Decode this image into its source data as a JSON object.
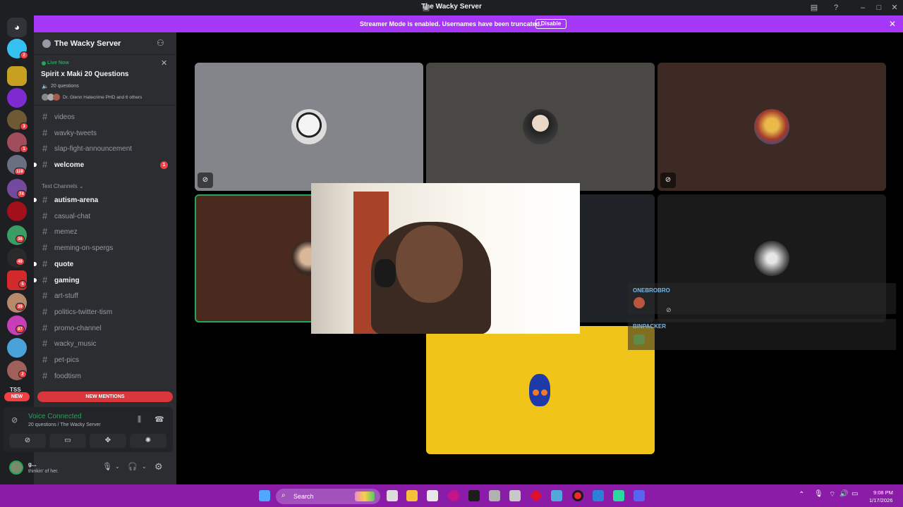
{
  "window": {
    "title": "The Wacky Server"
  },
  "banner": {
    "message": "Streamer Mode is enabled. Usernames have been truncated.",
    "disable_label": "Disable"
  },
  "server_list": {
    "badges": [
      "2",
      "3",
      "1",
      "119",
      "74",
      "36",
      "40",
      "5",
      "39",
      "87",
      "2"
    ],
    "new_label": "NEW",
    "tss_label": "TSS"
  },
  "sidebar": {
    "server_name": "The Wacky Server",
    "live": {
      "status": "Live Now",
      "title": "Spirit x Maki 20 Questions",
      "channel": "20 questions",
      "participants": "Dr. Glenn Hatecrime PHD and 6 others"
    },
    "channels_top": [
      {
        "name": "videos",
        "bold": false
      },
      {
        "name": "wavky-tweets",
        "bold": false
      },
      {
        "name": "slap-fight-announcement",
        "bold": false
      },
      {
        "name": "welcome",
        "bold": true,
        "badge": "1"
      }
    ],
    "category": "Text Channels",
    "channels": [
      {
        "name": "autism-arena",
        "bold": true
      },
      {
        "name": "casual-chat",
        "bold": false
      },
      {
        "name": "memez",
        "bold": false
      },
      {
        "name": "meming-on-spergs",
        "bold": false
      },
      {
        "name": "quote",
        "bold": true
      },
      {
        "name": "gaming",
        "bold": true
      },
      {
        "name": "art-stuff",
        "bold": false
      },
      {
        "name": "politics-twitter-tism",
        "bold": false
      },
      {
        "name": "promo-channel",
        "bold": false
      },
      {
        "name": "wacky_music",
        "bold": false
      },
      {
        "name": "pet-pics",
        "bold": false
      },
      {
        "name": "foodtism",
        "bold": false
      }
    ],
    "new_mentions": "NEW MENTIONS"
  },
  "voice": {
    "status": "Voice Connected",
    "location": "20 questions / The Wacky Server"
  },
  "user": {
    "name": "g...",
    "status": "thinkin' of her."
  },
  "stage": {
    "overlay_users": [
      "ONEBROBRO",
      "BINPACKER"
    ]
  },
  "taskbar": {
    "search_placeholder": "Search",
    "time": "9:08 PM",
    "date": "1/17/2026"
  },
  "colors": {
    "accent": "#a637f6",
    "taskbar": "#8a1ca8",
    "voice_green": "#23a55a",
    "yellow_tile": "#f0c419"
  }
}
